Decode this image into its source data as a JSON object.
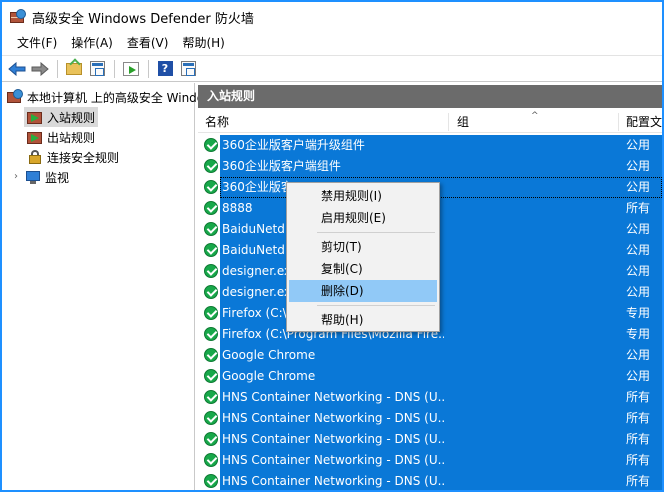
{
  "window": {
    "title": "高级安全 Windows Defender 防火墙"
  },
  "menubar": {
    "items": [
      "文件(F)",
      "操作(A)",
      "查看(V)",
      "帮助(H)"
    ]
  },
  "toolbar": {
    "buttons": [
      "back-arrow",
      "forward-arrow",
      "up-folder",
      "show-hide-console-tree",
      "export-list",
      "help",
      "show-hide-action-pane"
    ]
  },
  "tree": {
    "root": "本地计算机 上的高级安全 Windows Defender 防火墙",
    "items": [
      {
        "label": "入站规则",
        "selected": true
      },
      {
        "label": "出站规则",
        "selected": false
      },
      {
        "label": "连接安全规则",
        "selected": false
      },
      {
        "label": "监视",
        "selected": false
      }
    ]
  },
  "pane": {
    "header": "入站规则",
    "columns": {
      "name": "名称",
      "group": "组",
      "profile": "配置文"
    }
  },
  "rules": [
    {
      "name": "360企业版客户端升级组件",
      "profile": "公用"
    },
    {
      "name": "360企业版客户端组件",
      "profile": "公用"
    },
    {
      "name": "360企业版客",
      "profile": "公用"
    },
    {
      "name": "8888",
      "profile": "所有"
    },
    {
      "name": "BaiduNetdi",
      "profile": "公用"
    },
    {
      "name": "BaiduNetdi",
      "profile": "公用"
    },
    {
      "name": "designer.ex",
      "profile": "公用"
    },
    {
      "name": "designer.ex",
      "profile": "公用"
    },
    {
      "name": "Firefox (C:\\",
      "profile": "专用"
    },
    {
      "name": "Firefox (C:\\Program Files\\Mozilla Fire...",
      "profile": "专用"
    },
    {
      "name": "Google Chrome",
      "profile": "公用"
    },
    {
      "name": "Google Chrome",
      "profile": "公用"
    },
    {
      "name": "HNS Container Networking - DNS (U...",
      "profile": "所有"
    },
    {
      "name": "HNS Container Networking - DNS (U...",
      "profile": "所有"
    },
    {
      "name": "HNS Container Networking - DNS (U...",
      "profile": "所有"
    },
    {
      "name": "HNS Container Networking - DNS (U...",
      "profile": "所有"
    },
    {
      "name": "HNS Container Networking - DNS (U...",
      "profile": "所有"
    }
  ],
  "context_menu": {
    "items": [
      "禁用规则(I)",
      "启用规则(E)",
      "剪切(T)",
      "复制(C)",
      "删除(D)",
      "帮助(H)"
    ],
    "highlighted": "删除(D)"
  },
  "colors": {
    "selection": "#0a78d7",
    "frame_border": "#1e90ff",
    "pane_header": "#6b6b6b",
    "menu_highlight": "#91c9f7",
    "rule_enabled": "#18a84a"
  }
}
